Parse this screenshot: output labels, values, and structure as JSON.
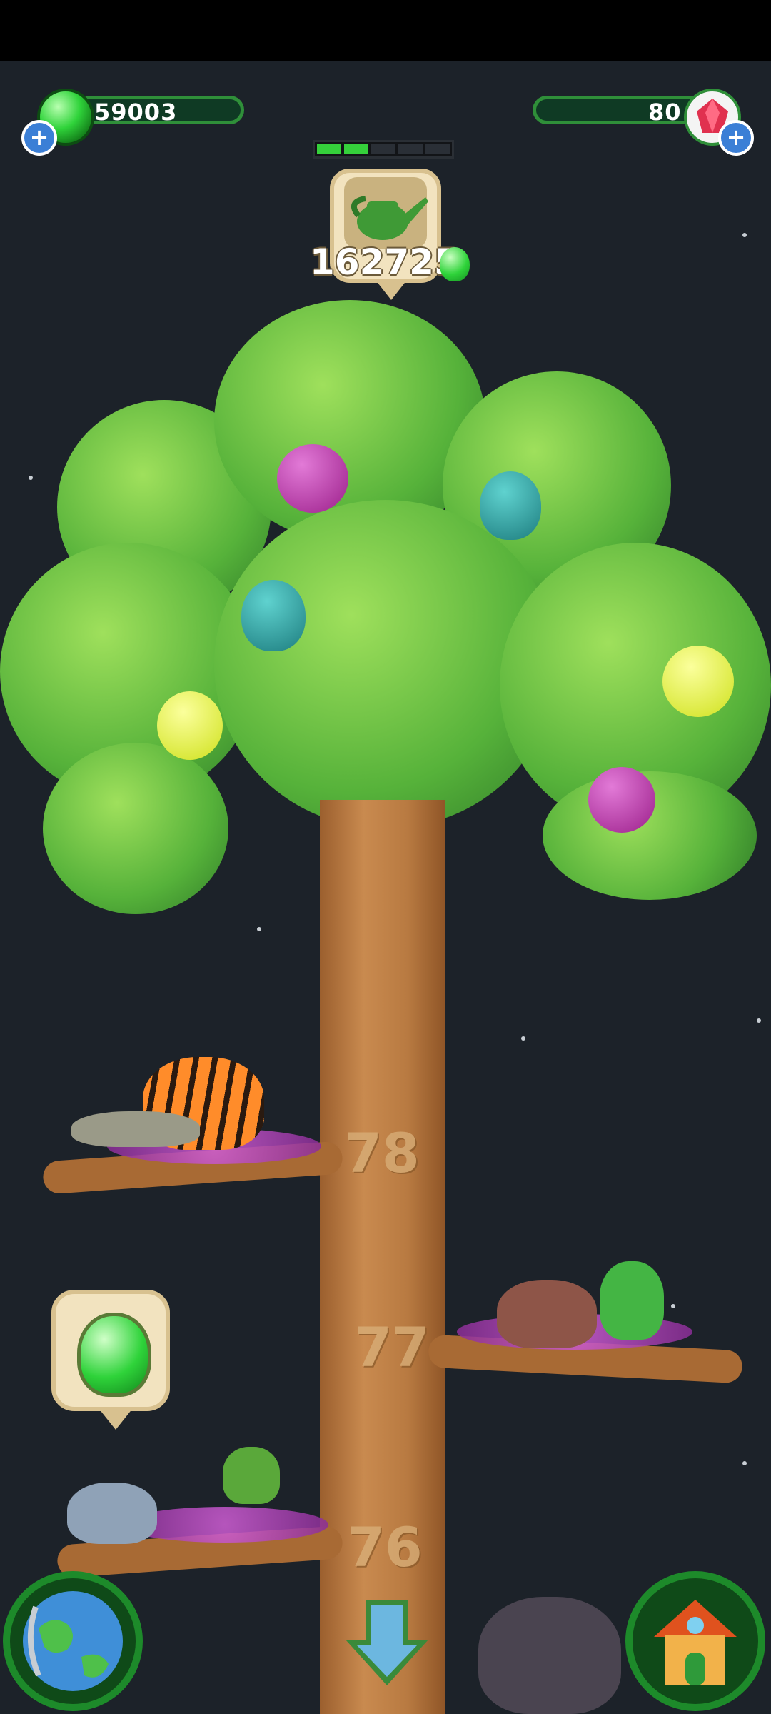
{
  "currency": {
    "seeds": "59003",
    "gems": "80"
  },
  "progress": {
    "filled_segments": 2,
    "total_segments": 5
  },
  "water_action": {
    "cost": "162725",
    "icon": "watering-can-icon"
  },
  "branches": [
    {
      "level": "78"
    },
    {
      "level": "77"
    },
    {
      "level": "76"
    }
  ],
  "colors": {
    "seed_green": "#2fd33a",
    "bar_green": "#2f8f39",
    "plus_blue": "#3b7fd6",
    "sky": "#1c2229"
  },
  "buttons": {
    "globe": "globe-icon",
    "home": "house-icon",
    "scroll_down": "down-arrow-icon"
  }
}
